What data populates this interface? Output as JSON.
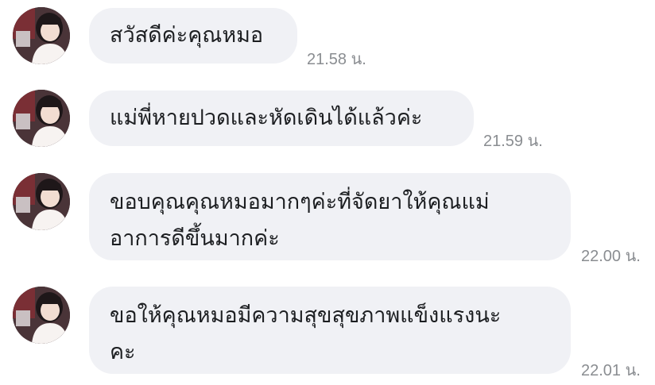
{
  "messages": [
    {
      "lines": [
        "สวัสดีค่ะคุณหมอ"
      ],
      "time": "21.58 น."
    },
    {
      "lines": [
        "แม่พี่หายปวดและหัดเดินได้แล้วค่ะ"
      ],
      "time": "21.59 น."
    },
    {
      "lines": [
        "ขอบคุณคุณหมอมากๆค่ะที่จัดยาให้คุณแม่",
        "อาการดีขึ้นมากค่ะ"
      ],
      "time": "22.00 น."
    },
    {
      "lines": [
        "ขอให้คุณหมอมีความสุขสุขภาพแข็งแรงนะ",
        "คะ"
      ],
      "time": "22.01 น."
    }
  ],
  "colors": {
    "bubble": "#f0f1f5",
    "text": "#1c1e21",
    "timestamp": "#8a8d91"
  },
  "icons": {
    "avatar": "sender-avatar-photo"
  }
}
